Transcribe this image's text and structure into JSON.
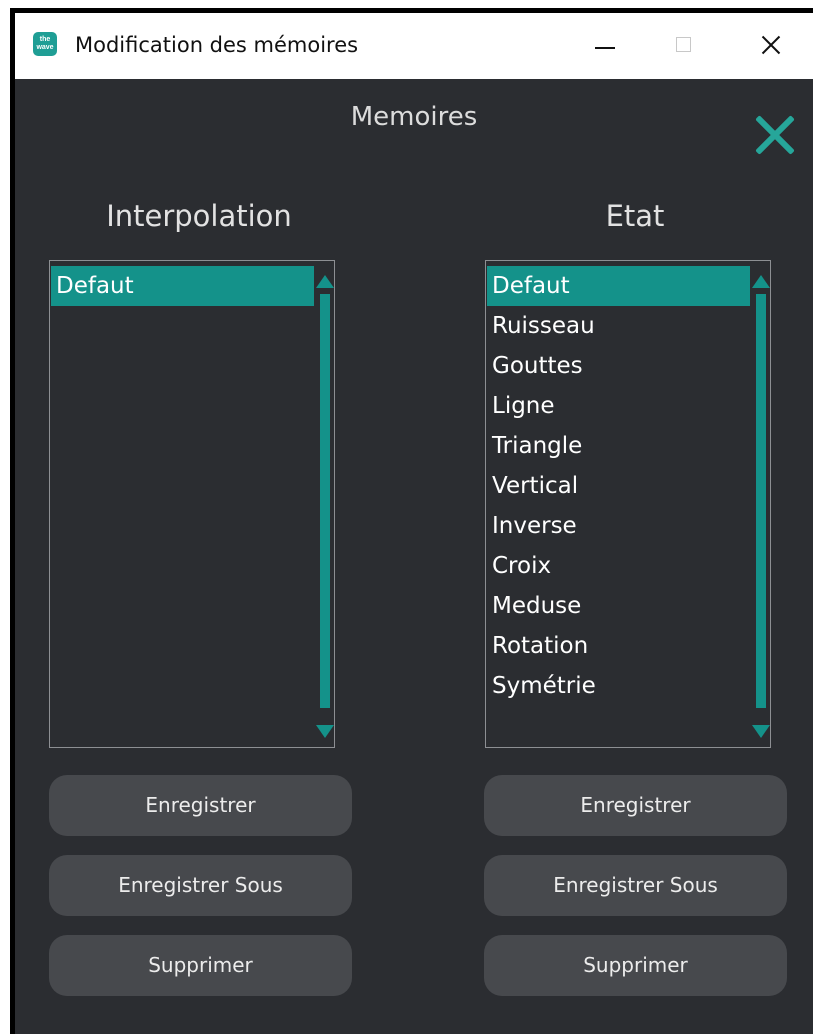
{
  "window": {
    "title": "Modification des mémoires",
    "icon_label": "the wave"
  },
  "heading": "Memoires",
  "colors": {
    "background": "#2b2d31",
    "accent": "#26a69a",
    "selection": "#14928a",
    "button": "#47494d"
  },
  "interpolation": {
    "title": "Interpolation",
    "items": [
      "Defaut"
    ],
    "selected": "Defaut",
    "buttons": {
      "save": "Enregistrer",
      "save_as": "Enregistrer Sous",
      "delete": "Supprimer"
    }
  },
  "etat": {
    "title": "Etat",
    "items": [
      "Defaut",
      "Ruisseau",
      "Gouttes",
      "Ligne",
      "Triangle",
      "Vertical",
      "Inverse",
      "Croix",
      "Meduse",
      "Rotation",
      "Symétrie"
    ],
    "selected": "Defaut",
    "buttons": {
      "save": "Enregistrer",
      "save_as": "Enregistrer Sous",
      "delete": "Supprimer"
    }
  },
  "icons": {
    "app": "app-logo-icon",
    "close": "close-x-icon",
    "scroll_up": "scroll-up-arrow-icon",
    "scroll_down": "scroll-down-arrow-icon"
  }
}
